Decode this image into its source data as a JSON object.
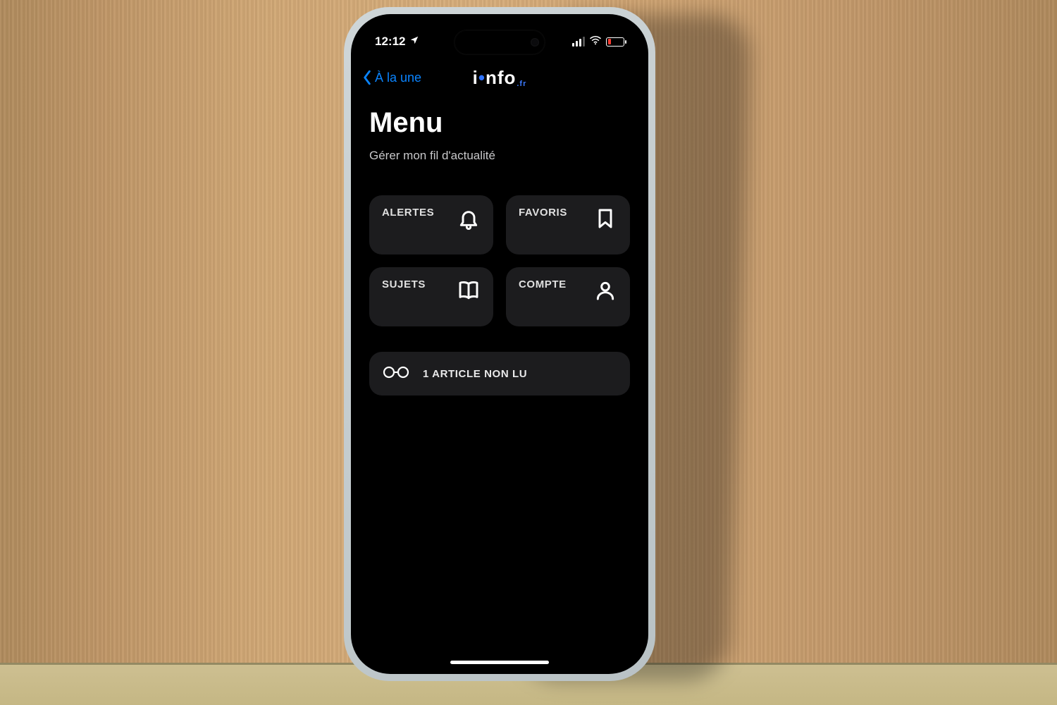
{
  "status": {
    "time": "12:12"
  },
  "nav": {
    "back_label": "À la une",
    "brand_left": "i",
    "brand_right": "nfo",
    "brand_suffix": ".fr"
  },
  "page": {
    "title": "Menu",
    "subtitle": "Gérer mon fil d'actualité"
  },
  "tiles": {
    "alerts": "ALERTES",
    "favorites": "FAVORIS",
    "subjects": "SUJETS",
    "account": "COMPTE"
  },
  "unread": {
    "label": "1 ARTICLE NON LU"
  }
}
